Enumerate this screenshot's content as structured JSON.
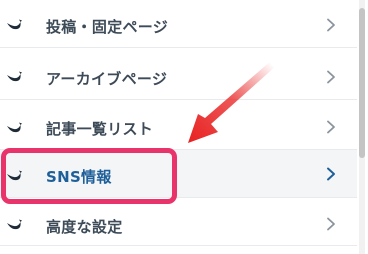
{
  "menu": {
    "items": [
      {
        "label": "投稿・固定ページ",
        "icon": "whale-icon",
        "chevron": "chevron-right-icon",
        "selected": false
      },
      {
        "label": "アーカイブページ",
        "icon": "whale-icon",
        "chevron": "chevron-right-icon",
        "selected": false
      },
      {
        "label": "記事一覧リスト",
        "icon": "whale-icon",
        "chevron": "chevron-right-icon",
        "selected": false
      },
      {
        "label": "SNS情報",
        "icon": "whale-icon",
        "chevron": "chevron-right-icon",
        "selected": true
      },
      {
        "label": "高度な設定",
        "icon": "whale-icon",
        "chevron": "chevron-right-icon",
        "selected": false
      }
    ]
  },
  "annotation": {
    "highlight_color": "#e8336b",
    "arrow_color": "#e82020"
  },
  "colors": {
    "label_text": "#3d4a57",
    "selected_text": "#1f5f99",
    "selected_background": "#f3f5f7",
    "icon_fill": "#1e2b38"
  }
}
